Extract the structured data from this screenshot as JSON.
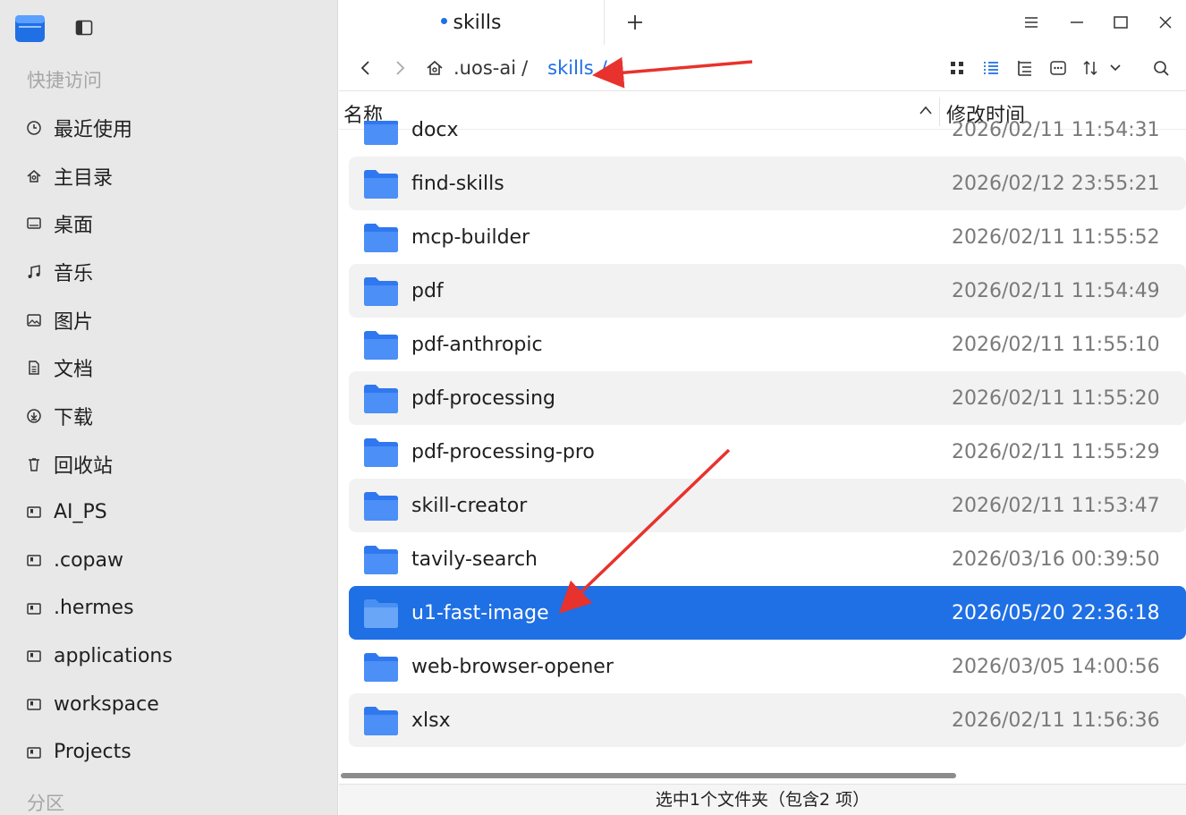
{
  "sidebar": {
    "quick_access_title": "快捷访问",
    "partition_title": "分区",
    "items": [
      {
        "label": "最近使用",
        "icon": "clock-icon"
      },
      {
        "label": "主目录",
        "icon": "home-icon"
      },
      {
        "label": "桌面",
        "icon": "desktop-icon"
      },
      {
        "label": "音乐",
        "icon": "music-icon"
      },
      {
        "label": "图片",
        "icon": "picture-icon"
      },
      {
        "label": "文档",
        "icon": "document-icon"
      },
      {
        "label": "下载",
        "icon": "download-icon"
      },
      {
        "label": "回收站",
        "icon": "trash-icon"
      },
      {
        "label": "AI_PS",
        "icon": "bookmark-folder-icon"
      },
      {
        "label": ".copaw",
        "icon": "bookmark-folder-icon"
      },
      {
        "label": ".hermes",
        "icon": "bookmark-folder-icon"
      },
      {
        "label": "applications",
        "icon": "bookmark-folder-icon"
      },
      {
        "label": "workspace",
        "icon": "bookmark-folder-icon"
      },
      {
        "label": "Projects",
        "icon": "bookmark-folder-icon"
      }
    ]
  },
  "tabs": [
    {
      "label": "skills"
    }
  ],
  "breadcrumb": {
    "items": [
      ".uos-ai",
      "skills"
    ],
    "separator": "/"
  },
  "columns": {
    "name": "名称",
    "modified": "修改时间"
  },
  "files": [
    {
      "name": "docx",
      "modified": "2026/02/11 11:54:31"
    },
    {
      "name": "find-skills",
      "modified": "2026/02/12 23:55:21"
    },
    {
      "name": "mcp-builder",
      "modified": "2026/02/11 11:55:52"
    },
    {
      "name": "pdf",
      "modified": "2026/02/11 11:54:49"
    },
    {
      "name": "pdf-anthropic",
      "modified": "2026/02/11 11:55:10"
    },
    {
      "name": "pdf-processing",
      "modified": "2026/02/11 11:55:20"
    },
    {
      "name": "pdf-processing-pro",
      "modified": "2026/02/11 11:55:29"
    },
    {
      "name": "skill-creator",
      "modified": "2026/02/11 11:53:47"
    },
    {
      "name": "tavily-search",
      "modified": "2026/03/16 00:39:50"
    },
    {
      "name": "u1-fast-image",
      "modified": "2026/05/20 22:36:18",
      "selected": true
    },
    {
      "name": "web-browser-opener",
      "modified": "2026/03/05 14:00:56"
    },
    {
      "name": "xlsx",
      "modified": "2026/02/11 11:56:36"
    }
  ],
  "status": "选中1个文件夹（包含2 项）",
  "colors": {
    "accent": "#1f6fe5",
    "annotation": "#e8322d",
    "folder": "#3d86f5"
  }
}
